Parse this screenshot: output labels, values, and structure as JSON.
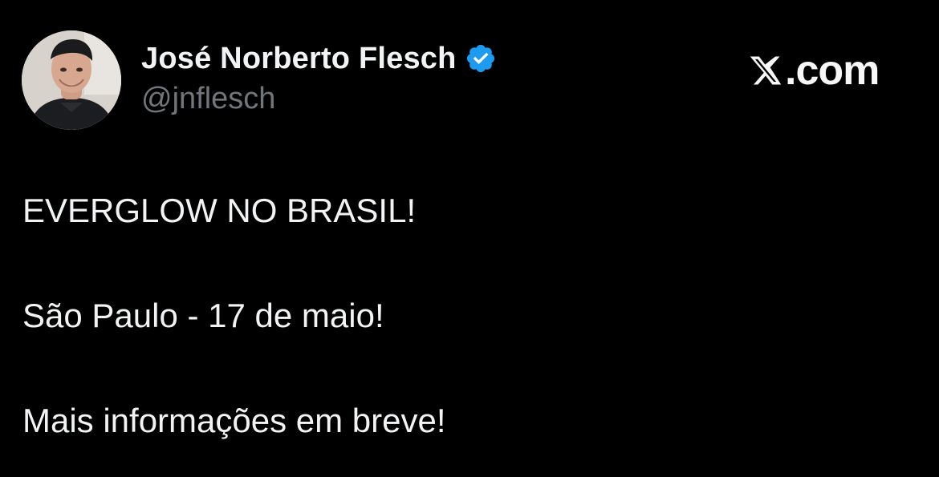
{
  "brand": {
    "domain": ".com",
    "logo_icon": "x-logo-icon"
  },
  "author": {
    "name": "José Norberto Flesch",
    "handle": "@jnflesch",
    "verified_icon": "verified-badge-icon",
    "verified_color": "#1d9bf0",
    "avatar_icon": "avatar"
  },
  "tweet": {
    "lines": [
      "EVERGLOW NO BRASIL!",
      "São Paulo - 17 de maio!",
      "Mais informações em breve!"
    ]
  },
  "colors": {
    "background": "#000000",
    "text": "#f2f3f4",
    "muted": "#71767b",
    "accent": "#1d9bf0"
  }
}
